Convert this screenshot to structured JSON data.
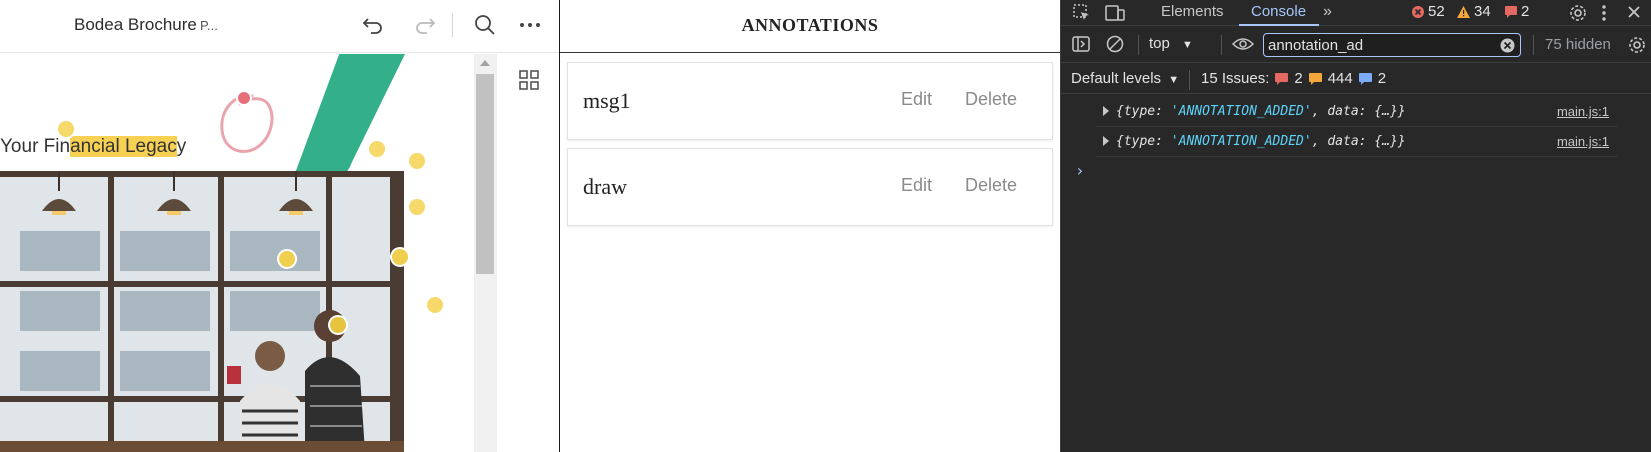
{
  "viewer": {
    "title": "Bodea Brochure",
    "title_extra": "P...",
    "icons": [
      "undo-icon",
      "redo-icon",
      "search-icon",
      "more-icon",
      "grid-icon"
    ],
    "page": {
      "heading_before": "Your Fin",
      "heading_highlight": "ancial Legac",
      "heading_after": "y",
      "accent_green": "#33b08a",
      "highlight_color": "#f7d154",
      "note_color": "#f7d86a"
    }
  },
  "annotations": {
    "title": "ANNOTATIONS",
    "items": [
      {
        "text": "msg1",
        "edit_label": "Edit",
        "delete_label": "Delete"
      },
      {
        "text": "draw",
        "edit_label": "Edit",
        "delete_label": "Delete"
      }
    ]
  },
  "devtools": {
    "tabs": [
      "Elements",
      "Console"
    ],
    "active_tab": "Console",
    "error_count": "52",
    "warning_count": "34",
    "info_count": "2",
    "context": "top",
    "filter_value": "annotation_ad",
    "hidden_label": "75 hidden",
    "levels_label": "Default levels",
    "issues_label": "15 Issues:",
    "issues_errors": "2",
    "issues_warnings": "444",
    "issues_info": "2",
    "logs": [
      {
        "prefix": "{type: ",
        "type_value": "'ANNOTATION_ADDED'",
        "suffix": ", data: {…}}",
        "source": "main.js:1"
      },
      {
        "prefix": "{type: ",
        "type_value": "'ANNOTATION_ADDED'",
        "suffix": ", data: {…}}",
        "source": "main.js:1"
      }
    ],
    "prompt": "›"
  }
}
